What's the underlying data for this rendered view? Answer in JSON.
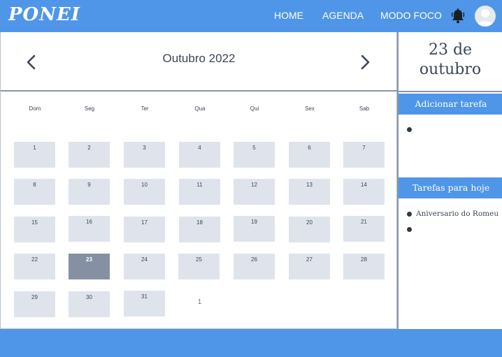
{
  "header": {
    "logo": "PONEI",
    "nav": {
      "home": "HOME",
      "agenda": "AGENDA",
      "foco": "MODO FOCO"
    },
    "icons": {
      "bell": "bell-icon",
      "avatar": "user-avatar-icon"
    },
    "colors": {
      "primary": "#4f96e8",
      "today_cell": "#8591a3",
      "day_cell": "#dfe4ec"
    }
  },
  "calendar": {
    "month_label": "Outubro 2022",
    "weekdays": [
      "Dom",
      "Seg",
      "Ter",
      "Qua",
      "Qui",
      "Sex",
      "Sab"
    ],
    "today": "23",
    "days": [
      [
        "1",
        "2",
        "3",
        "4",
        "5",
        "6",
        "7"
      ],
      [
        "8",
        "9",
        "10",
        "11",
        "12",
        "13",
        "14"
      ],
      [
        "15",
        "16",
        "17",
        "18",
        "19",
        "20",
        "21"
      ],
      [
        "22",
        "23",
        "24",
        "25",
        "26",
        "27",
        "28"
      ],
      [
        "29",
        "30",
        "31",
        "1"
      ]
    ]
  },
  "sidebar": {
    "date_line1": "23 de",
    "date_line2": "outubro",
    "add_task_label": "Adicionar tarefa",
    "today_tasks_label": "Tarefas para hoje",
    "today_tasks": [
      "Aniversario do Romeu",
      ""
    ]
  }
}
